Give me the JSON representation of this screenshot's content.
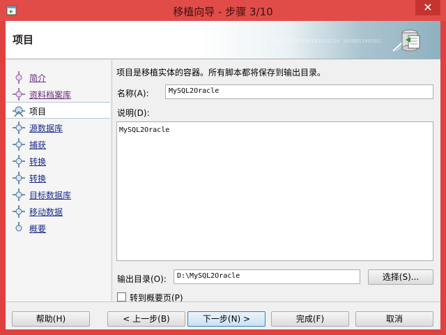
{
  "window": {
    "title": "移植向导 - 步骤 3/10",
    "close_glyph": "✕"
  },
  "header": {
    "title": "项目",
    "digits": "0101010101100101010110 1010011001011010 0101101011 010101100101011100101"
  },
  "sidebar": {
    "items": [
      {
        "label": "简介",
        "state": "visited"
      },
      {
        "label": "资料档案库",
        "state": "visited"
      },
      {
        "label": "项目",
        "state": "active"
      },
      {
        "label": "源数据库",
        "state": "pending"
      },
      {
        "label": "捕获",
        "state": "pending"
      },
      {
        "label": "转换",
        "state": "pending"
      },
      {
        "label": "转换",
        "state": "pending"
      },
      {
        "label": "目标数据库",
        "state": "pending"
      },
      {
        "label": "移动数据",
        "state": "pending"
      },
      {
        "label": "概要",
        "state": "pending"
      }
    ]
  },
  "main": {
    "description": "项目是移植实体的容器。所有脚本都将保存到输出目录。",
    "name_label": "名称(A):",
    "name_value": "MySQL2Oracle",
    "desc_label": "说明(D):",
    "desc_value": "MySQL2Oracle",
    "output_label": "输出目录(O):",
    "output_value": "D:\\MySQL2Oracle",
    "choose_button": "选择(S)...",
    "goto_summary_label": "转到概要页(P)",
    "goto_summary_checked": false
  },
  "footer": {
    "help": "帮助(H)",
    "back": "< 上一步(B)",
    "next": "下一步(N) >",
    "finish": "完成(F)",
    "cancel": "取消"
  },
  "colors": {
    "titlebar": "#e14c49",
    "visited_link": "#6a2a7a",
    "pending_link": "#1a2a8a"
  }
}
